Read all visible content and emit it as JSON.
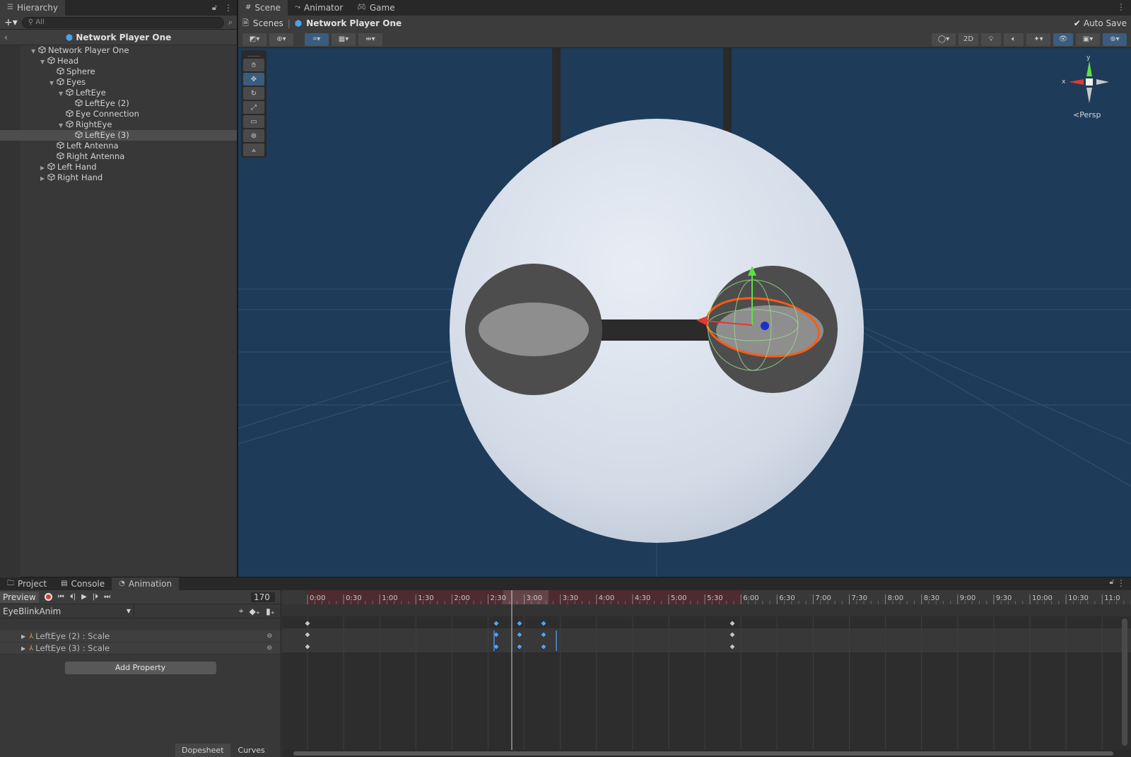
{
  "hierarchy": {
    "tab_label": "Hierarchy",
    "search_placeholder": "All",
    "scene_name": "Network Player One",
    "items": [
      {
        "label": "Network Player One",
        "depth": 0,
        "expanded": true
      },
      {
        "label": "Head",
        "depth": 1,
        "expanded": true
      },
      {
        "label": "Sphere",
        "depth": 2,
        "expanded": null
      },
      {
        "label": "Eyes",
        "depth": 2,
        "expanded": true
      },
      {
        "label": "LeftEye",
        "depth": 3,
        "expanded": true
      },
      {
        "label": "LeftEye (2)",
        "depth": 4,
        "expanded": null
      },
      {
        "label": "Eye Connection",
        "depth": 3,
        "expanded": null
      },
      {
        "label": "RightEye",
        "depth": 3,
        "expanded": true
      },
      {
        "label": "LeftEye (3)",
        "depth": 4,
        "expanded": null,
        "selected": true
      },
      {
        "label": "Left Antenna",
        "depth": 2,
        "expanded": null
      },
      {
        "label": "Right Antenna",
        "depth": 2,
        "expanded": null
      },
      {
        "label": "Left Hand",
        "depth": 1,
        "expanded": false
      },
      {
        "label": "Right Hand",
        "depth": 1,
        "expanded": false
      }
    ]
  },
  "scene": {
    "tabs": [
      "Scene",
      "Animator",
      "Game"
    ],
    "breadcrumb_root": "Scenes",
    "breadcrumb_current": "Network Player One",
    "auto_save_label": "Auto Save",
    "auto_save_checked": true,
    "mode_2d_label": "2D",
    "gizmo_persp_label": "Persp",
    "axis_x": "x",
    "axis_y": "y"
  },
  "animation": {
    "tabs": [
      "Project",
      "Console",
      "Animation"
    ],
    "preview_label": "Preview",
    "frame_value": "170",
    "clip_name": "EyeBlinkAnim",
    "properties": [
      "LeftEye (2) : Scale",
      "LeftEye (3) : Scale"
    ],
    "add_property_label": "Add Property",
    "bottom_tabs": [
      "Dopesheet",
      "Curves"
    ],
    "timeline_labels": [
      "0:00",
      "0:30",
      "1:00",
      "1:30",
      "2:00",
      "2:30",
      "3:00",
      "3:30",
      "4:00",
      "4:30",
      "5:00",
      "5:30",
      "6:00",
      "6:30",
      "7:00",
      "7:30",
      "8:00",
      "8:30",
      "9:00",
      "9:30",
      "10:00",
      "10:30",
      "11:0"
    ]
  },
  "colors": {
    "accent_blue": "#3a79bb",
    "record_red": "#d43c3c",
    "timeline_range": "#4d2b30",
    "viewport_bg": "#1e3b5a"
  }
}
